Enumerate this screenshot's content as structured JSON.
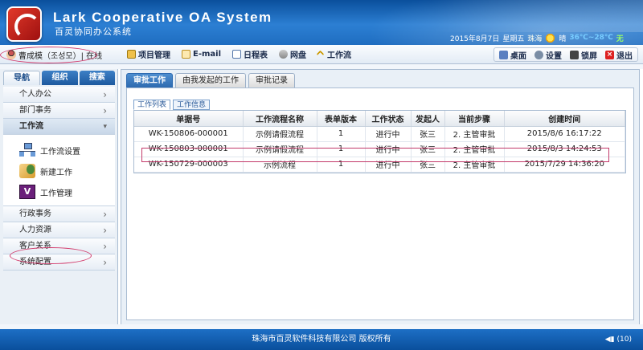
{
  "header": {
    "title_en": "Lark Cooperative OA System",
    "title_cn": "百灵协同办公系统",
    "date": "2015年8月7日",
    "weekday": "星期五",
    "city": "珠海",
    "weather": "晴",
    "temp": "36℃~28℃",
    "wind": "无"
  },
  "toolbar": {
    "user_label": "曹成模（조성모）| 在线",
    "items": [
      "项目管理",
      "E-mail",
      "日程表",
      "网盘",
      "工作流"
    ],
    "right": [
      "桌面",
      "设置",
      "锁屏",
      "退出"
    ]
  },
  "sidebar": {
    "tabs": [
      "导航",
      "组织",
      "搜索"
    ],
    "menu_top": [
      "个人办公",
      "部门事务",
      "工作流"
    ],
    "workflow_sub": [
      "工作流设置",
      "新建工作",
      "工作管理"
    ],
    "menu_bottom": [
      "行政事务",
      "人力资源",
      "客户关系",
      "系统配置"
    ]
  },
  "main": {
    "tabs": [
      "审批工作",
      "由我发起的工作",
      "审批记录"
    ],
    "subtabs": [
      "工作列表",
      "工作信息"
    ],
    "columns": [
      "单据号",
      "工作流程名称",
      "表单版本",
      "工作状态",
      "发起人",
      "当前步骤",
      "创建时间"
    ],
    "rows": [
      [
        "WK-150806-000001",
        "示例请假流程",
        "1",
        "进行中",
        "张三",
        "2. 主管审批",
        "2015/8/6 16:17:22"
      ],
      [
        "WK-150803-000001",
        "示例请假流程",
        "1",
        "进行中",
        "张三",
        "2. 主管审批",
        "2015/8/3 14:24:53"
      ],
      [
        "WK-150729-000003",
        "示例流程",
        "1",
        "进行中",
        "张三",
        "2. 主管审批",
        "2015/7/29 14:36:20"
      ]
    ]
  },
  "footer": {
    "text": "珠海市百灵软件科技有限公司 版权所有",
    "count": "(10)"
  }
}
